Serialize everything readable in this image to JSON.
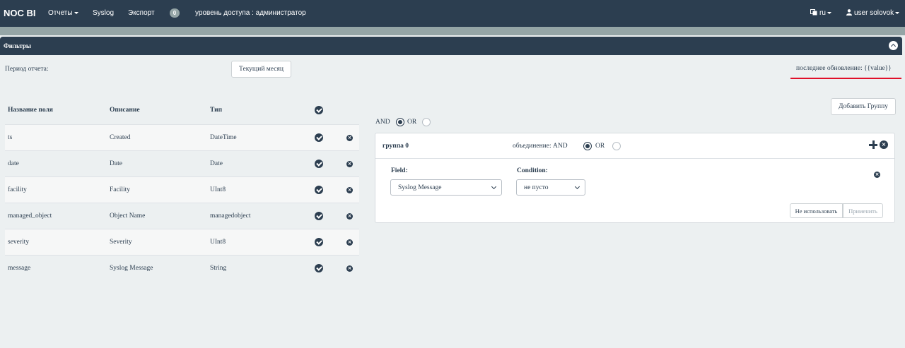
{
  "nav": {
    "brand": "NOC BI",
    "reports": "Отчеты",
    "syslog": "Syslog",
    "export": "Экспорт",
    "badge": "0",
    "access_level": "уровень доступа : администратор",
    "language": "ru",
    "user": "user solovok"
  },
  "filters_panel": {
    "title": "Фильтры",
    "period_label": "Период отчета:",
    "period_button": "Текущий месяц",
    "last_update": "последнее обновление: {{value}}"
  },
  "fields_table": {
    "headers": [
      "Название поля",
      "Описание",
      "Тип"
    ],
    "rows": [
      [
        "ts",
        "Created",
        "DateTime"
      ],
      [
        "date",
        "Date",
        "Date"
      ],
      [
        "facility",
        "Facility",
        "UInt8"
      ],
      [
        "managed_object",
        "Object Name",
        "managedobject"
      ],
      [
        "severity",
        "Severity",
        "UInt8"
      ],
      [
        "message",
        "Syslog Message",
        "String"
      ]
    ]
  },
  "groups": {
    "add_group_button": "Добавить Группу",
    "and_label": "AND",
    "or_label": "OR",
    "selected": "AND",
    "group": {
      "title": "группа 0",
      "union_label": "объединение: AND",
      "or_label": "OR",
      "selected": "AND",
      "field_label": "Field:",
      "field_value": "Syslog Message",
      "condition_label": "Condition:",
      "condition_value": "не пусто",
      "disable_button": "Не использовать",
      "apply_button": "Применить"
    }
  }
}
